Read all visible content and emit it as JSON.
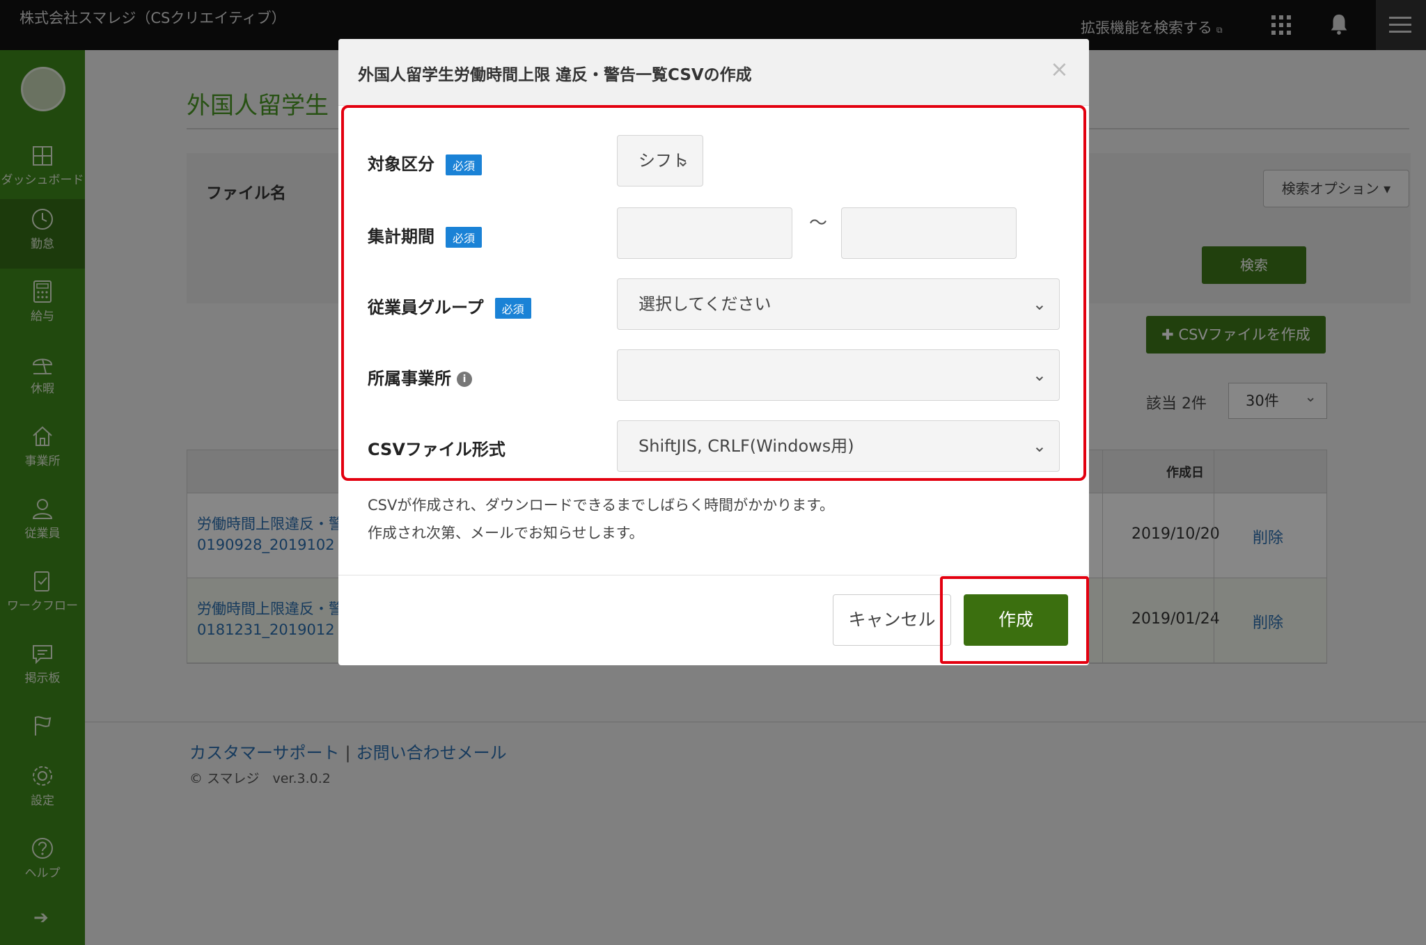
{
  "topbar": {
    "company": "株式会社スマレジ（CSクリエイティブ）",
    "ext_search": "拡張機能を検索する",
    "ext_mark": "⧉"
  },
  "sidebar": {
    "items": [
      {
        "label": "ダッシュボード",
        "icon": "dashboard-icon"
      },
      {
        "label": "勤怠",
        "icon": "clock-icon"
      },
      {
        "label": "給与",
        "icon": "calculator-icon"
      },
      {
        "label": "休暇",
        "icon": "umbrella-icon"
      },
      {
        "label": "事業所",
        "icon": "home-icon"
      },
      {
        "label": "従業員",
        "icon": "person-icon"
      },
      {
        "label": "ワークフロー",
        "icon": "clipboard-icon"
      },
      {
        "label": "掲示板",
        "icon": "chat-icon"
      },
      {
        "label": "",
        "icon": "flag-icon"
      },
      {
        "label": "設定",
        "icon": "gear-icon"
      },
      {
        "label": "ヘルプ",
        "icon": "help-icon"
      }
    ],
    "arrow": "➔"
  },
  "page": {
    "title": "外国人留学生",
    "file_name_label": "ファイル名",
    "search_option": "検索オプション ▾",
    "search_button": "検索",
    "csv_create_button": "✚ CSVファイルを作成",
    "hit_count": "該当 2件",
    "per_page": "30件",
    "table": {
      "date_header": "作成日",
      "rows": [
        {
          "name_line1": "労働時間上限違反・警",
          "name_line2": "0190928_2019102",
          "date": "2019/10/20",
          "action": "削除"
        },
        {
          "name_line1": "労働時間上限違反・警",
          "name_line2": "0181231_2019012",
          "date": "2019/01/24",
          "action": "削除"
        }
      ]
    }
  },
  "footer": {
    "support": "カスタマーサポート",
    "separator": "|",
    "contact": "お問い合わせメール",
    "copyright": "© スマレジ　ver.3.0.2"
  },
  "modal": {
    "title": "外国人留学生労働時間上限 違反・警告一覧CSVの作成",
    "close": "×",
    "required_badge": "必須",
    "fields": {
      "target": {
        "label": "対象区分",
        "value": "シフト"
      },
      "period": {
        "label": "集計期間",
        "separator": "〜",
        "from": "",
        "to": ""
      },
      "group": {
        "label": "従業員グループ",
        "placeholder": "選択してください"
      },
      "office": {
        "label": "所属事業所",
        "value": ""
      },
      "format": {
        "label": "CSVファイル形式",
        "value": "ShiftJIS, CRLF(Windows用)"
      }
    },
    "note_line1": "CSVが作成され、ダウンロードできるまでしばらく時間がかかります。",
    "note_line2": "作成され次第、メールでお知らせします。",
    "cancel_label": "キャンセル",
    "create_label": "作成"
  },
  "colors": {
    "sidebar_green": "#3f8a1c",
    "button_green": "#3b6f0f",
    "highlight_red": "#e3000f",
    "required_blue": "#1a82d6"
  }
}
